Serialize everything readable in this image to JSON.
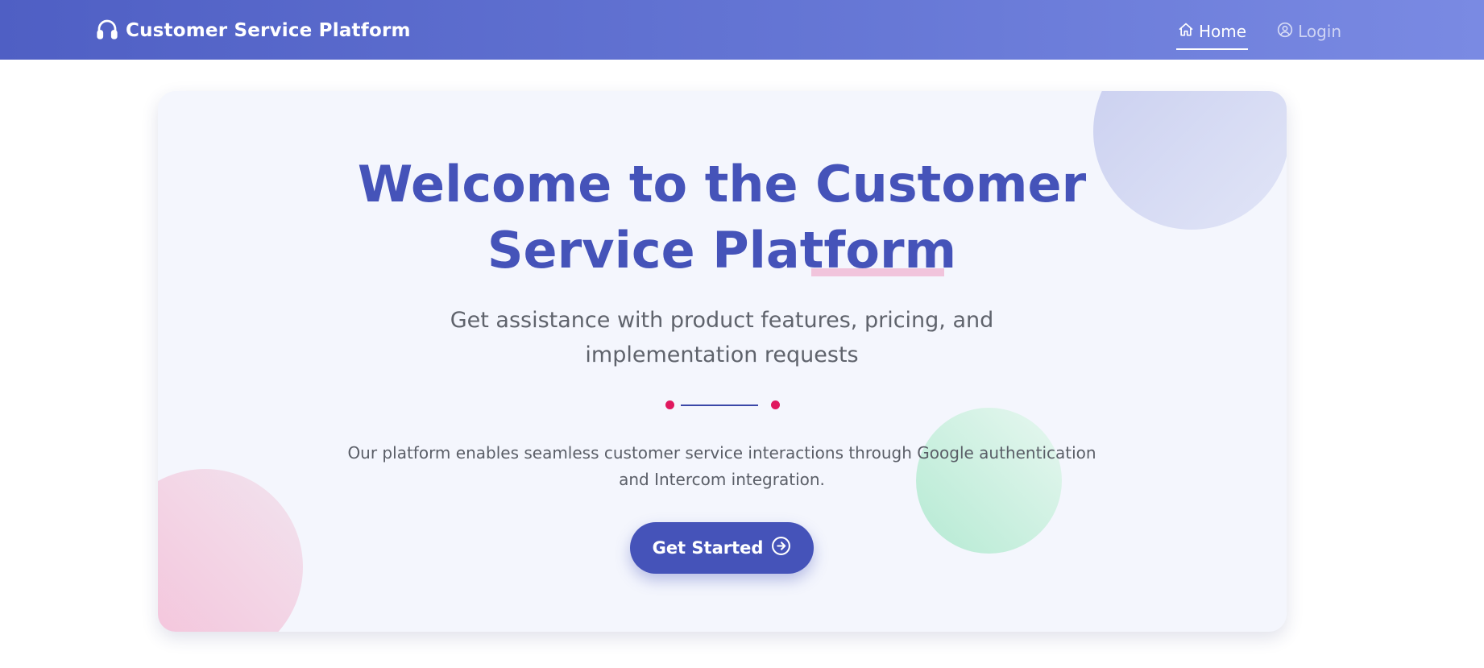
{
  "navbar": {
    "brand_icon": "headset-icon",
    "brand_title": "Customer Service Platform",
    "links": [
      {
        "label": "Home",
        "icon": "home-icon",
        "active": true
      },
      {
        "label": "Login",
        "icon": "user-circle-icon",
        "active": false
      }
    ]
  },
  "hero": {
    "title_line1": "Welcome to the Customer",
    "title_line2": "Service Platform",
    "subtitle": "Get assistance with product features, pricing, and implementation requests",
    "description": "Our platform enables seamless customer service interactions through Google authentication and Intercom integration.",
    "cta_label": "Get Started",
    "cta_icon": "arrow-right-circle-icon"
  },
  "colors": {
    "brand_gradient_start": "#4f5fc4",
    "brand_gradient_end": "#7a8ae3",
    "primary": "#4553b9",
    "accent_pink": "#e0185e",
    "card_background": "#f4f6fd"
  }
}
